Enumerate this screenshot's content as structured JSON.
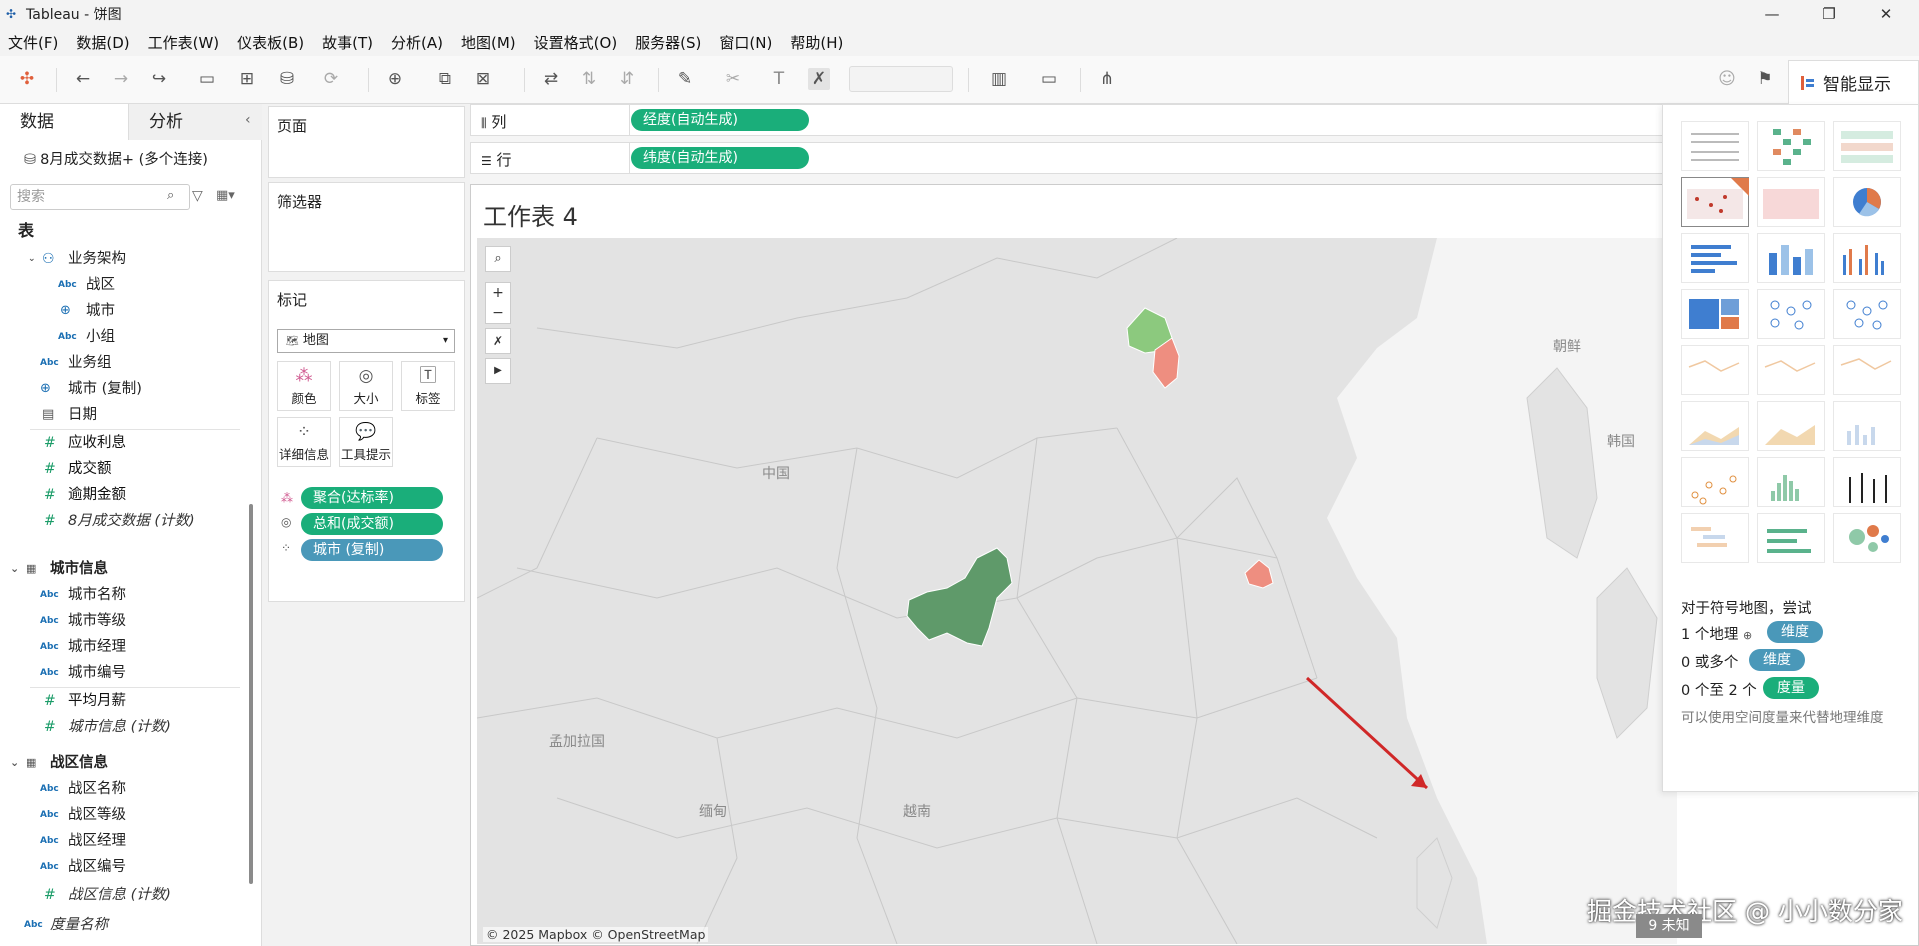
{
  "window": {
    "title": "Tableau - 饼图"
  },
  "menu": [
    "文件(F)",
    "数据(D)",
    "工作表(W)",
    "仪表板(B)",
    "故事(T)",
    "分析(A)",
    "地图(M)",
    "设置格式(O)",
    "服务器(S)",
    "窗口(N)",
    "帮助(H)"
  ],
  "toolbar": {
    "smart_show": "智能显示"
  },
  "data_pane": {
    "tab_data": "数据",
    "tab_analysis": "分析",
    "connection": "8月成交数据+ (多个连接)",
    "search_placeholder": "搜索",
    "table_header": "表",
    "fields": [
      {
        "type": "hier",
        "name": "业务架构"
      },
      {
        "type": "Abc",
        "name": "战区"
      },
      {
        "type": "geo",
        "name": "城市"
      },
      {
        "type": "Abc",
        "name": "小组"
      },
      {
        "type": "Abc",
        "name": "业务组"
      },
      {
        "type": "geo",
        "name": "城市 (复制)"
      },
      {
        "type": "date",
        "name": "日期"
      },
      {
        "type": "#",
        "name": "应收利息"
      },
      {
        "type": "#",
        "name": "成交额"
      },
      {
        "type": "#",
        "name": "逾期金额"
      },
      {
        "type": "#",
        "name": "8月成交数据 (计数)"
      }
    ],
    "group_city": {
      "name": "城市信息",
      "fields": [
        "城市名称",
        "城市等级",
        "城市经理",
        "城市编号"
      ],
      "measures": [
        "平均月薪",
        "城市信息 (计数)"
      ]
    },
    "group_zone": {
      "name": "战区信息",
      "fields": [
        "战区名称",
        "战区等级",
        "战区经理",
        "战区编号"
      ],
      "measures": [
        "战区信息 (计数)"
      ]
    },
    "measure_names": "度量名称"
  },
  "shelves": {
    "pages": "页面",
    "filters": "筛选器",
    "marks": "标记",
    "marks_type": "地图",
    "mark_buttons": [
      "颜色",
      "大小",
      "标签",
      "详细信息",
      "工具提示"
    ],
    "mark_pills": [
      "聚合(达标率)",
      "总和(成交额)",
      "城市 (复制)"
    ],
    "columns_label": "列",
    "columns_pill": "经度(自动生成)",
    "rows_label": "行",
    "rows_pill": "纬度(自动生成)"
  },
  "sheet": {
    "title": "工作表 4",
    "map_labels": [
      "中国",
      "朝鲜",
      "韩国",
      "孟加拉国",
      "缅甸",
      "越南"
    ],
    "credit": "© 2025 Mapbox © OpenStreetMap",
    "colors": {
      "beijing": "#8cc97e",
      "hebei": "#ee8e80",
      "chongqing": "#5f9a6a",
      "shanghai": "#ee8e80"
    }
  },
  "smart_show": {
    "hint_title": "对于符号地图，尝试",
    "req1": "1 个地理",
    "req1_pill": "维度",
    "req2": "0 或多个",
    "req2_pill": "维度",
    "req3": "0 个至 2 个",
    "req3_pill": "度量",
    "note": "可以使用空间度量来代替地理维度"
  },
  "overlay": {
    "watermark": "掘金技术社区 @ 小小数分家",
    "unknown": "9 未知"
  }
}
